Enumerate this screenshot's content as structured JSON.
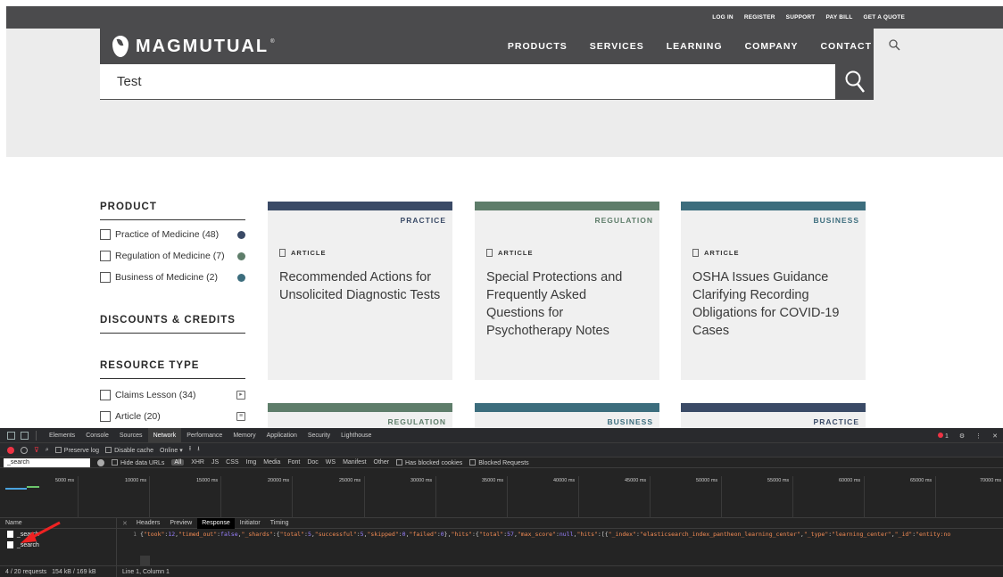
{
  "site": {
    "util_links": [
      "LOG IN",
      "REGISTER",
      "SUPPORT",
      "PAY BILL",
      "GET A QUOTE"
    ],
    "brand": "MAGMUTUAL",
    "brand_mark": "®",
    "nav": [
      "PRODUCTS",
      "SERVICES",
      "LEARNING",
      "COMPANY",
      "CONTACT"
    ],
    "search_value": "Test",
    "sidebar": {
      "product_heading": "PRODUCT",
      "products": [
        {
          "label": "Practice of Medicine (48)",
          "color": "#3a4a66"
        },
        {
          "label": "Regulation of Medicine (7)",
          "color": "#5e7d6a"
        },
        {
          "label": "Business of Medicine (2)",
          "color": "#3c6d7d"
        }
      ],
      "discounts_heading": "DISCOUNTS & CREDITS",
      "resource_heading": "RESOURCE TYPE",
      "resources": [
        {
          "label": "Claims Lesson (34)",
          "icon": "play-icon"
        },
        {
          "label": "Article (20)",
          "icon": "document-icon"
        }
      ]
    },
    "cards": [
      {
        "tag": "PRACTICE",
        "type": "ARTICLE",
        "title": "Recommended Actions for Unsolicited Diagnostic Tests",
        "color": "#3a4a66"
      },
      {
        "tag": "REGULATION",
        "type": "ARTICLE",
        "title": "Special Protections and Frequently Asked Questions for Psychotherapy Notes",
        "color": "#5e7d6a"
      },
      {
        "tag": "BUSINESS",
        "type": "ARTICLE",
        "title": "OSHA Issues Guidance Clarifying Recording Obligations for COVID-19 Cases",
        "color": "#3c6d7d"
      },
      {
        "tag": "REGULATION",
        "color": "#5e7d6a"
      },
      {
        "tag": "BUSINESS",
        "color": "#3c6d7d"
      },
      {
        "tag": "PRACTICE",
        "color": "#3a4a66"
      }
    ]
  },
  "devtools": {
    "tabs": [
      "Elements",
      "Console",
      "Sources",
      "Network",
      "Performance",
      "Memory",
      "Application",
      "Security",
      "Lighthouse"
    ],
    "active_tab": "Network",
    "error_count": "1",
    "toolbar": {
      "preserve_log": "Preserve log",
      "disable_cache": "Disable cache",
      "throttle": "Online"
    },
    "filter_value": "_search",
    "filter_types": [
      "Hide data URLs",
      "All",
      "XHR",
      "JS",
      "CSS",
      "Img",
      "Media",
      "Font",
      "Doc",
      "WS",
      "Manifest",
      "Other"
    ],
    "has_blocked": "Has blocked cookies",
    "blocked_requests": "Blocked Requests",
    "timeline_ticks": [
      "5000 ms",
      "10000 ms",
      "15000 ms",
      "20000 ms",
      "25000 ms",
      "30000 ms",
      "35000 ms",
      "40000 ms",
      "45000 ms",
      "50000 ms",
      "55000 ms",
      "60000 ms",
      "65000 ms",
      "70000 ms"
    ],
    "name_header": "Name",
    "requests": [
      "_search",
      "_search"
    ],
    "status": "4 / 20 requests",
    "size": "154 kB / 169 kB",
    "detail_tabs": [
      "Headers",
      "Preview",
      "Response",
      "Initiator",
      "Timing"
    ],
    "active_detail_tab": "Response",
    "line_no": "1",
    "cursor": "Line 1, Column 1"
  }
}
